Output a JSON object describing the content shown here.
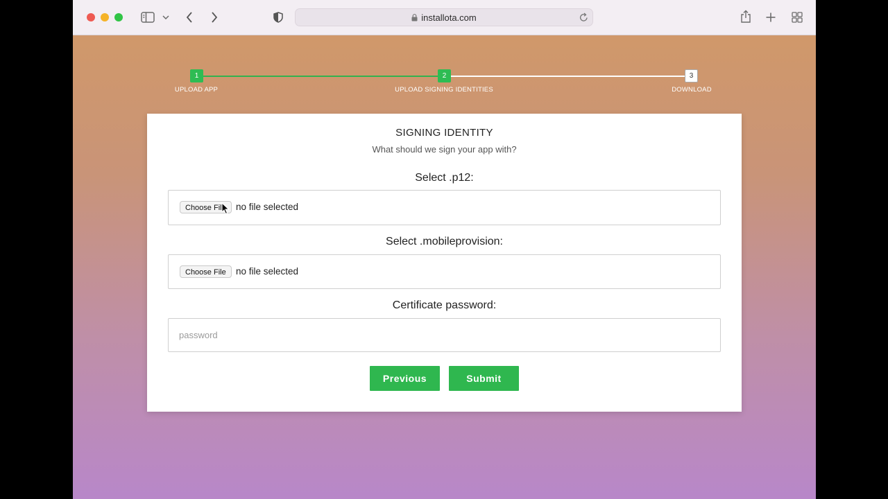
{
  "browser": {
    "url": "installota.com",
    "icons": [
      "sidebar-icon",
      "chevron-down-icon",
      "back-icon",
      "forward-icon",
      "shield-icon",
      "lock-icon",
      "reload-icon",
      "share-icon",
      "new-tab-icon",
      "tab-overview-icon"
    ]
  },
  "stepper": {
    "steps": [
      {
        "number": "1",
        "label": "UPLOAD APP",
        "state": "complete"
      },
      {
        "number": "2",
        "label": "UPLOAD SIGNING IDENTITIES",
        "state": "current"
      },
      {
        "number": "3",
        "label": "DOWNLOAD",
        "state": "pending"
      }
    ]
  },
  "card": {
    "title": "SIGNING IDENTITY",
    "subtitle": "What should we sign your app with?",
    "p12": {
      "label": "Select .p12:",
      "button": "Choose File",
      "status": "no file selected"
    },
    "mobileprovision": {
      "label": "Select .mobileprovision:",
      "button": "Choose File",
      "status": "no file selected"
    },
    "password": {
      "label": "Certificate password:",
      "placeholder": "password",
      "value": ""
    },
    "buttons": {
      "previous": "Previous",
      "submit": "Submit"
    }
  },
  "colors": {
    "accent_green": "#2fb74f",
    "gradient_top": "#d0986a",
    "gradient_bottom": "#b887c9"
  }
}
